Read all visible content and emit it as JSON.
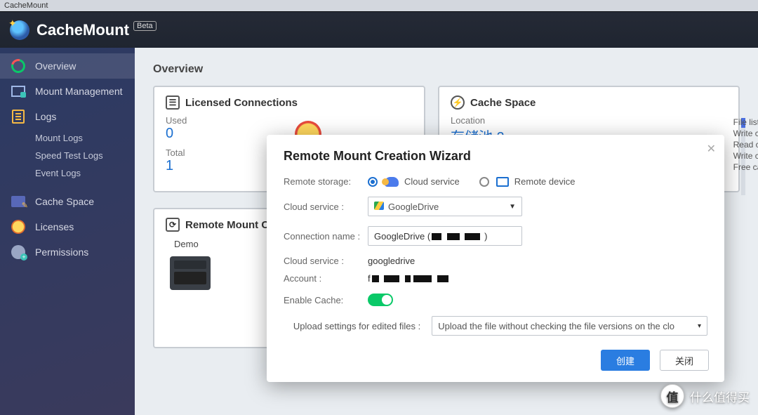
{
  "titlebar": "CacheMount",
  "app": {
    "name": "CacheMount",
    "badge": "Beta"
  },
  "sidebar": {
    "items": [
      {
        "label": "Overview"
      },
      {
        "label": "Mount Management"
      },
      {
        "label": "Logs",
        "children": [
          "Mount Logs",
          "Speed Test Logs",
          "Event Logs"
        ]
      },
      {
        "label": "Cache Space"
      },
      {
        "label": "Licenses"
      },
      {
        "label": "Permissions"
      }
    ]
  },
  "page": {
    "title": "Overview"
  },
  "licensed": {
    "title": "Licensed Connections",
    "used_label": "Used",
    "used": "0",
    "total_label": "Total",
    "total": "1"
  },
  "cache": {
    "title": "Cache Space",
    "loc_label": "Location",
    "loc_value": "存储池 2",
    "lines": [
      "File list m",
      "Write cac",
      "Read cac",
      "Write cac",
      "Free cach"
    ]
  },
  "rmc": {
    "title": "Remote Mount Co",
    "node": "Demo"
  },
  "modal": {
    "title": "Remote Mount Creation Wizard",
    "remote_storage_label": "Remote storage:",
    "opt_cloud": "Cloud service",
    "opt_device": "Remote device",
    "cloud_service_label": "Cloud service :",
    "cloud_service_value": "GoogleDrive",
    "conn_name_label": "Connection name :",
    "conn_name_value": "GoogleDrive (",
    "cloud_service_label2": "Cloud service :",
    "cloud_service_value2": "googledrive",
    "account_label": "Account :",
    "enable_cache_label": "Enable Cache:",
    "upload_label": "Upload settings for edited files :",
    "upload_value": "Upload the file without checking the file versions on the clo",
    "btn_primary": "创建",
    "btn_secondary": "关闭"
  },
  "watermark": "什么值得买"
}
